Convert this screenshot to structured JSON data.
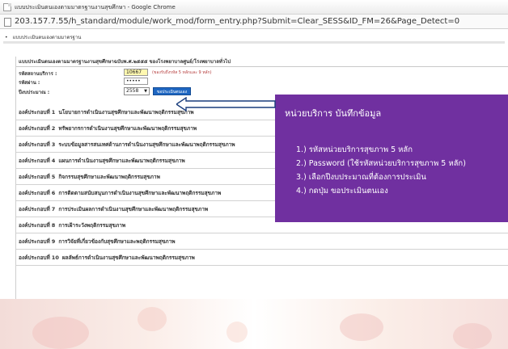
{
  "window": {
    "title": "แบบประเมินตนเองตามมาตรฐานงานสุขศึกษา - Google Chrome",
    "url": "203.157.7.55/h_standard/module/work_mod/form_entry.php?Submit=Clear_SESS&ID_FM=26&Page_Detect=0"
  },
  "breadcrumb": "แบบประเมินตนเองตามมาตรฐาน",
  "form": {
    "title": "แบบประเมินตนเองตามมาตรฐานงานสุขศึกษาฉบับพ.ศ.๒๕๕๕ ของโรงพยาบาลศูนย์/โรงพยาบาลทั่วไป",
    "unit_label": "รหัสสถานบริการ :",
    "unit_value": "10667",
    "unit_hint": "(ของรับถึงรหัส 5 หลักและ 9 หลัก)",
    "password_label": "รหัสผ่าน :",
    "password_value": "•••••",
    "year_label": "ปีงบประมาณ :",
    "year_value": "2558",
    "evaluate_button": "ขอประเมินตนเอง"
  },
  "components": [
    {
      "prefix": "องค์ประกอบที่",
      "num": "1",
      "topic": "นโยบายการดำเนินงานสุขศึกษาและพัฒนาพฤติกรรมสุขภาพ"
    },
    {
      "prefix": "องค์ประกอบที่",
      "num": "2",
      "topic": "ทรัพยากรการดำเนินงานสุขศึกษาและพัฒนาพฤติกรรมสุขภาพ"
    },
    {
      "prefix": "องค์ประกอบที่",
      "num": "3",
      "topic": "ระบบข้อมูลสารสนเทศด้านการดำเนินงานสุขศึกษาและพัฒนาพฤติกรรมสุขภาพ"
    },
    {
      "prefix": "องค์ประกอบที่",
      "num": "4",
      "topic": "แผนการดำเนินงานสุขศึกษาและพัฒนาพฤติกรรมสุขภาพ"
    },
    {
      "prefix": "องค์ประกอบที่",
      "num": "5",
      "topic": "กิจกรรมสุขศึกษาและพัฒนาพฤติกรรมสุขภาพ"
    },
    {
      "prefix": "องค์ประกอบที่",
      "num": "6",
      "topic": "การติดตามสนับสนุนการดำเนินงานสุขศึกษาและพัฒนาพฤติกรรมสุขภาพ"
    },
    {
      "prefix": "องค์ประกอบที่",
      "num": "7",
      "topic": "การประเมินผลการดำเนินงานสุขศึกษาและพัฒนาพฤติกรรมสุขภาพ"
    },
    {
      "prefix": "องค์ประกอบที่",
      "num": "8",
      "topic": "การเฝ้าระวังพฤติกรรมสุขภาพ"
    },
    {
      "prefix": "องค์ประกอบที่",
      "num": "9",
      "topic": "การวิจัยที่เกี่ยวข้องกับสุขศึกษาและพฤติกรรมสุขภาพ"
    },
    {
      "prefix": "องค์ประกอบที่",
      "num": "10",
      "topic": "ผลลัพธ์การดำเนินงานสุขศึกษาและพัฒนาพฤติกรรมสุขภาพ"
    }
  ],
  "overlay": {
    "title": "หน่วยบริการ บันทึกข้อมูล",
    "steps": [
      "1.) รหัสหน่วยบริการสุขภาพ 5 หลัก",
      "2.) Password (ใช้รหัสหน่วยบริการสุขภาพ 5 หลัก)",
      "3.) เลือกปีงบประมาณที่ต้องการประเมิน",
      "4.) กดปุ่ม ขอประเมินตนเอง"
    ]
  },
  "colors": {
    "overlay": "#7030a0",
    "button": "#1f67c2",
    "hint": "#b53c3c",
    "input_highlight": "#fff8b0"
  }
}
